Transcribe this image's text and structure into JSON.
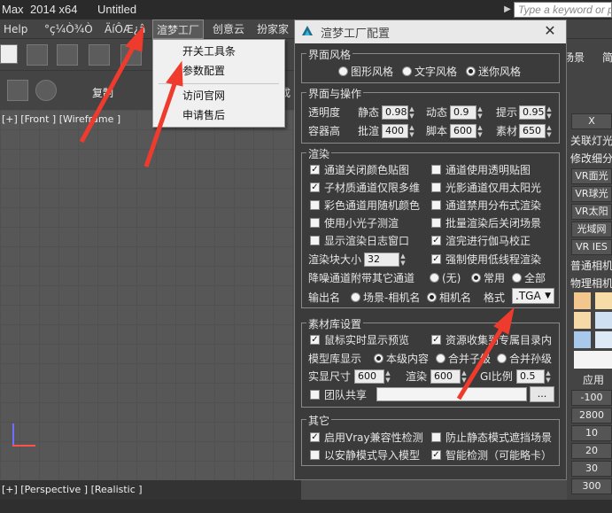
{
  "window": {
    "title_app": "Max",
    "title_version": "2014 x64",
    "title_file": "Untitled",
    "search_placeholder": "Type a keyword or p"
  },
  "menubar": {
    "items": [
      "Help",
      "°ç¼Ò¾Ò",
      "ÄíÔÆ¿â",
      "渲梦工厂",
      "创意云",
      "扮家家"
    ]
  },
  "dropdown": {
    "items": [
      "开关工具条",
      "参数配置",
      "访问官网",
      "申请售后"
    ]
  },
  "toolbar": {
    "copy_label": "复制",
    "viewport_label": "[+] [Front ] [Wireframe ]",
    "viewport2_label": "[+] [Perspective ] [Realistic ]"
  },
  "right_panel": {
    "top_label": "场景",
    "top_label2": "简",
    "x_button": "X",
    "items": [
      "关联灯光",
      "修改细分",
      "VR面光",
      "VR球光",
      "VR太阳",
      "光域网",
      "VR IES",
      "普通相机",
      "物理相机"
    ],
    "apply_label": "应用",
    "values": [
      "-100",
      "2800",
      "10",
      "20",
      "30",
      "300"
    ]
  },
  "dialog": {
    "title": "渲梦工厂配置",
    "ui_style": {
      "group_title": "界面风格",
      "options": [
        "图形风格",
        "文字风格",
        "迷你风格"
      ],
      "selected_index": 2
    },
    "ui_ops": {
      "group_title": "界面与操作",
      "row1_label": "透明度",
      "static_label": "静态",
      "static_value": "0.98",
      "dynamic_label": "动态",
      "dynamic_value": "0.9",
      "hint_label": "提示",
      "hint_value": "0.95",
      "row2_label": "容器高",
      "batch_label": "批渲",
      "batch_value": "400",
      "script_label": "脚本",
      "script_value": "600",
      "material_label": "素材",
      "material_value": "650"
    },
    "render": {
      "group_title": "渲染",
      "checks": [
        {
          "label": "通道关闭颜色贴图",
          "checked": true
        },
        {
          "label": "通道使用透明贴图",
          "checked": false
        },
        {
          "label": "子材质通道仅限多维",
          "checked": true
        },
        {
          "label": "光影通道仅用太阳光",
          "checked": false
        },
        {
          "label": "彩色通道用随机颜色",
          "checked": false
        },
        {
          "label": "通道禁用分布式渲染",
          "checked": false
        },
        {
          "label": "使用小光子测渲",
          "checked": false
        },
        {
          "label": "批量渲染后关闭场景",
          "checked": false
        },
        {
          "label": "显示渲染日志窗口",
          "checked": false
        },
        {
          "label": "渲完进行伽马校正",
          "checked": true
        },
        {
          "label": "强制使用低线程渲染",
          "checked": true
        }
      ],
      "block_size_label": "渲染块大小",
      "block_size_value": "32",
      "noise_label": "降噪通道附带其它通道",
      "noise_options": [
        "(无)",
        "常用",
        "全部"
      ],
      "noise_selected": 1,
      "output_label": "输出名",
      "output_options": [
        "场景-相机名",
        "相机名"
      ],
      "output_selected": 1,
      "format_label": "格式",
      "format_value": ".TGA"
    },
    "library": {
      "group_title": "素材库设置",
      "checks": [
        {
          "label": "鼠标实时显示预览",
          "checked": true
        },
        {
          "label": "资源收集到专属目录内",
          "checked": true
        }
      ],
      "model_display_label": "模型库显示",
      "model_options": [
        "本级内容",
        "合并子级",
        "合并孙级"
      ],
      "model_selected": 0,
      "real_size_label": "实显尺寸",
      "real_size_value": "600",
      "render_label": "渲染",
      "render_value": "600",
      "gi_label": "GI比例",
      "gi_value": "0.5",
      "team_share_label": "团队共享",
      "team_share_checked": false,
      "team_share_path": "",
      "browse_label": "..."
    },
    "other": {
      "group_title": "其它",
      "checks": [
        {
          "label": "启用Vray兼容性检测",
          "checked": true
        },
        {
          "label": "防止静态模式遮挡场景",
          "checked": false
        },
        {
          "label": "以安静模式导入模型",
          "checked": false
        },
        {
          "label": "智能检测（可能略卡）",
          "checked": true
        }
      ]
    }
  },
  "colors": {
    "annotation_arrow": "#ef3b2d",
    "dialog_bg": "#3b3b3b",
    "title_bar": "#2a2a2a"
  }
}
